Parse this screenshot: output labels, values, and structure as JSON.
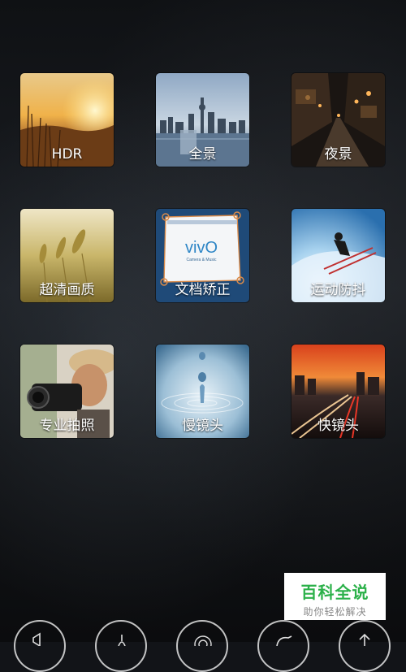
{
  "modes": [
    {
      "label": "HDR",
      "icon": "hdr-sunset-image"
    },
    {
      "label": "全景",
      "icon": "panorama-city-image"
    },
    {
      "label": "夜景",
      "icon": "night-street-image"
    },
    {
      "label": "超清画质",
      "icon": "wheat-field-image"
    },
    {
      "label": "文档矫正",
      "icon": "document-correction-image"
    },
    {
      "label": "运动防抖",
      "icon": "skier-image"
    },
    {
      "label": "专业拍照",
      "icon": "photographer-image"
    },
    {
      "label": "慢镜头",
      "icon": "water-drop-image"
    },
    {
      "label": "快镜头",
      "icon": "light-trails-image"
    }
  ],
  "document_tile": {
    "logo_text": "vivO",
    "tagline": "Camera & Music"
  },
  "watermark": {
    "title": "百科全说",
    "subtitle": "助你轻松解决"
  },
  "bottom_controls": [
    "volume-icon",
    "timer-icon",
    "target-icon",
    "refresh-icon",
    "rotate-icon"
  ],
  "colors": {
    "background": "#121418",
    "label_text": "#ffffff",
    "watermark_green": "#2cb14a"
  }
}
